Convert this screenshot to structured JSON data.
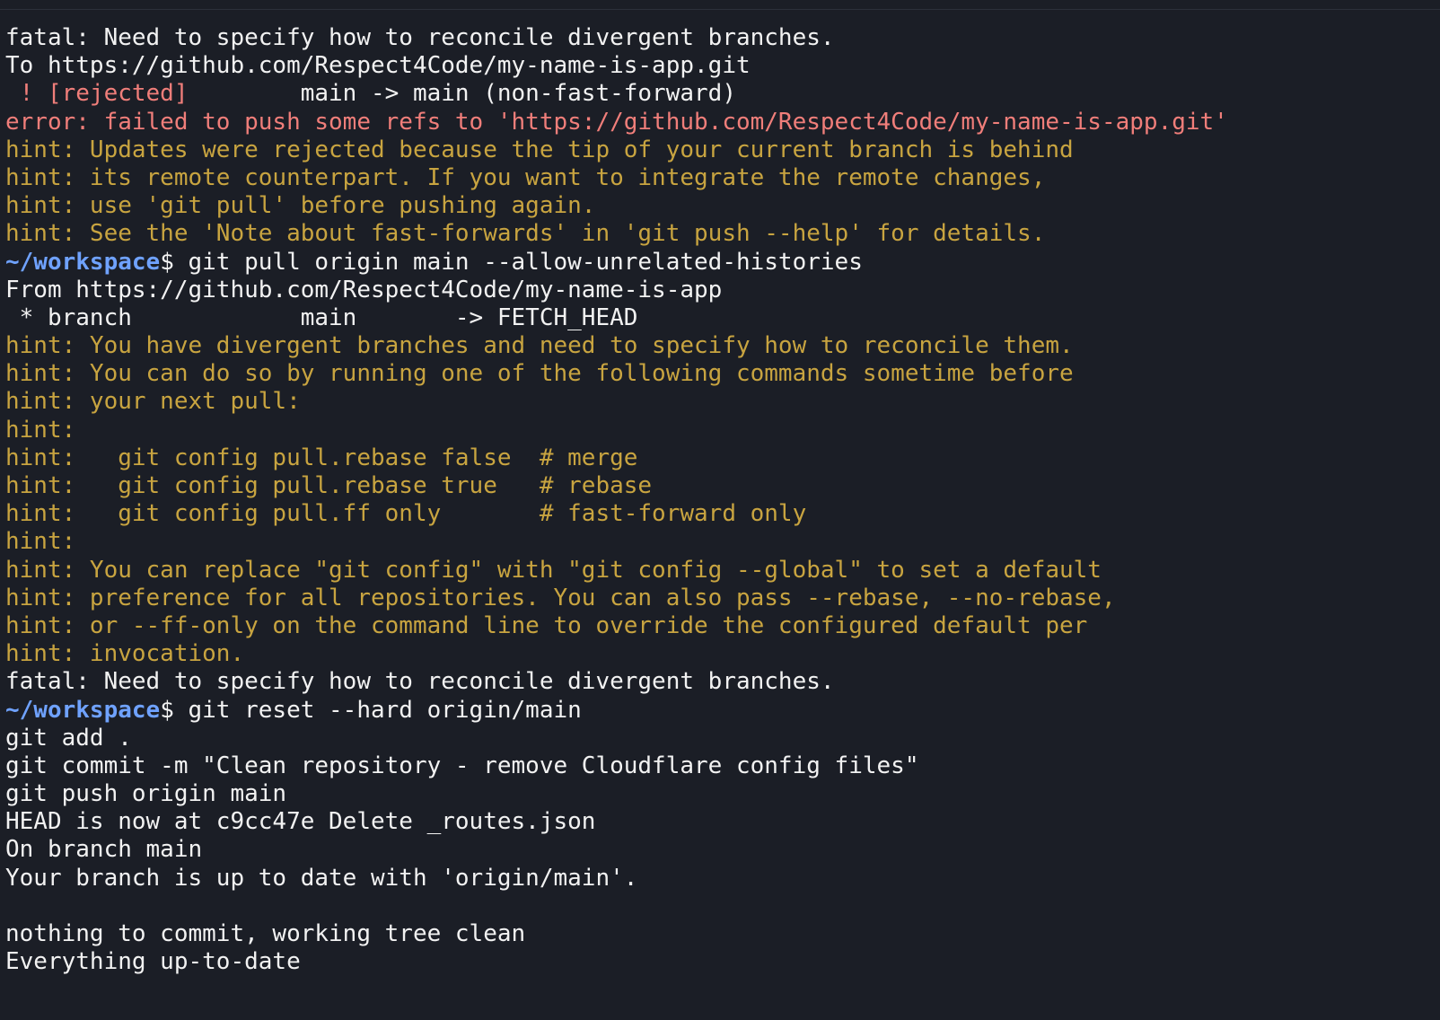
{
  "colors": {
    "background": "#1b1e26",
    "text": "#f2f2f2",
    "error": "#f07e7a",
    "hint": "#c8a440",
    "prompt": "#6fa2ff"
  },
  "lines": [
    {
      "kind": "default",
      "text": "fatal: Need to specify how to reconcile divergent branches."
    },
    {
      "kind": "default",
      "text": "To https://github.com/Respect4Code/my-name-is-app.git"
    },
    {
      "kind": "mixed",
      "parts": [
        {
          "kind": "red",
          "text": " ! [rejected]"
        },
        {
          "kind": "default",
          "text": "        main -> main (non-fast-forward)"
        }
      ]
    },
    {
      "kind": "red",
      "text": "error: failed to push some refs to 'https://github.com/Respect4Code/my-name-is-app.git'"
    },
    {
      "kind": "hint",
      "text": "hint: Updates were rejected because the tip of your current branch is behind"
    },
    {
      "kind": "hint",
      "text": "hint: its remote counterpart. If you want to integrate the remote changes,"
    },
    {
      "kind": "hint",
      "text": "hint: use 'git pull' before pushing again."
    },
    {
      "kind": "hint",
      "text": "hint: See the 'Note about fast-forwards' in 'git push --help' for details."
    },
    {
      "kind": "prompt",
      "prompt": "~/workspace",
      "command": "$ git pull origin main --allow-unrelated-histories"
    },
    {
      "kind": "default",
      "text": "From https://github.com/Respect4Code/my-name-is-app"
    },
    {
      "kind": "default",
      "text": " * branch            main       -> FETCH_HEAD"
    },
    {
      "kind": "hint",
      "text": "hint: You have divergent branches and need to specify how to reconcile them."
    },
    {
      "kind": "hint",
      "text": "hint: You can do so by running one of the following commands sometime before"
    },
    {
      "kind": "hint",
      "text": "hint: your next pull:"
    },
    {
      "kind": "hint",
      "text": "hint:"
    },
    {
      "kind": "hint",
      "text": "hint:   git config pull.rebase false  # merge"
    },
    {
      "kind": "hint",
      "text": "hint:   git config pull.rebase true   # rebase"
    },
    {
      "kind": "hint",
      "text": "hint:   git config pull.ff only       # fast-forward only"
    },
    {
      "kind": "hint",
      "text": "hint:"
    },
    {
      "kind": "hint",
      "text": "hint: You can replace \"git config\" with \"git config --global\" to set a default"
    },
    {
      "kind": "hint",
      "text": "hint: preference for all repositories. You can also pass --rebase, --no-rebase,"
    },
    {
      "kind": "hint",
      "text": "hint: or --ff-only on the command line to override the configured default per"
    },
    {
      "kind": "hint",
      "text": "hint: invocation."
    },
    {
      "kind": "default",
      "text": "fatal: Need to specify how to reconcile divergent branches."
    },
    {
      "kind": "prompt",
      "prompt": "~/workspace",
      "command": "$ git reset --hard origin/main"
    },
    {
      "kind": "default",
      "text": "git add ."
    },
    {
      "kind": "default",
      "text": "git commit -m \"Clean repository - remove Cloudflare config files\""
    },
    {
      "kind": "default",
      "text": "git push origin main"
    },
    {
      "kind": "default",
      "text": "HEAD is now at c9cc47e Delete _routes.json"
    },
    {
      "kind": "default",
      "text": "On branch main"
    },
    {
      "kind": "default",
      "text": "Your branch is up to date with 'origin/main'."
    },
    {
      "kind": "default",
      "text": ""
    },
    {
      "kind": "default",
      "text": "nothing to commit, working tree clean"
    },
    {
      "kind": "default",
      "text": "Everything up-to-date"
    }
  ]
}
